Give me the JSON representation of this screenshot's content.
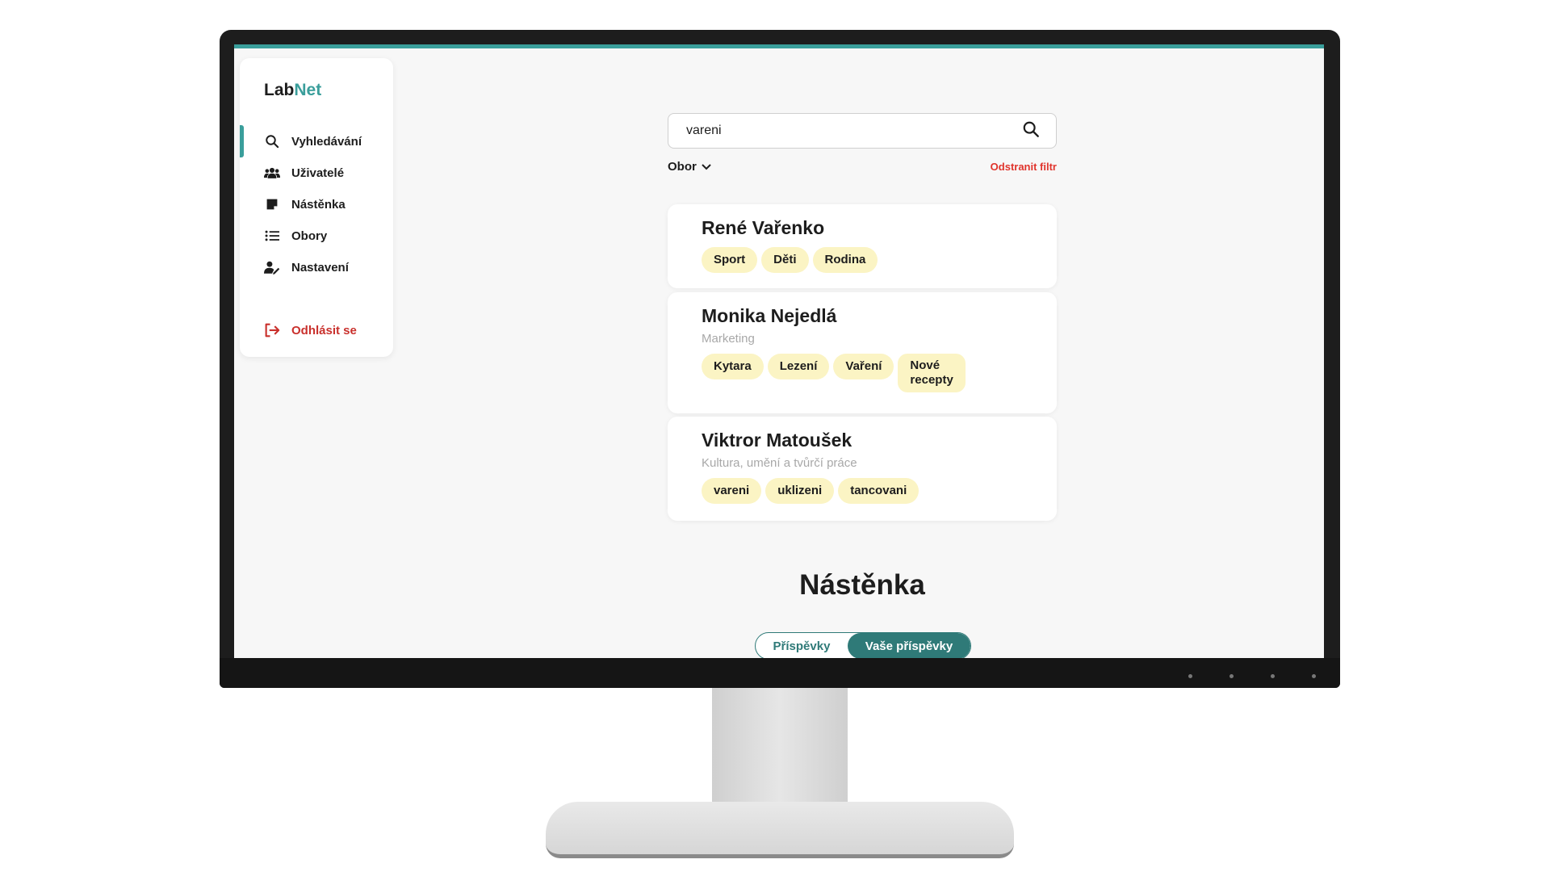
{
  "app": {
    "brand_part1": "Lab",
    "brand_part2": "Net",
    "accent_color": "#3a9e9b"
  },
  "sidebar": {
    "items": [
      {
        "label": "Vyhledávání",
        "icon": "search-icon",
        "active": true
      },
      {
        "label": "Uživatelé",
        "icon": "users-icon"
      },
      {
        "label": "Nástěnka",
        "icon": "note-icon"
      },
      {
        "label": "Obory",
        "icon": "list-icon"
      },
      {
        "label": "Nastavení",
        "icon": "user-settings-icon"
      }
    ],
    "logout": {
      "label": "Odhlásit se",
      "icon": "logout-icon",
      "color": "#c9302c"
    }
  },
  "search": {
    "value": "vareni",
    "icon": "search-icon"
  },
  "filter": {
    "dropdown_label": "Obor",
    "remove_label": "Odstranit filtr"
  },
  "results": [
    {
      "name": "René Vařenko",
      "dept": "",
      "tags": [
        "Sport",
        "Děti",
        "Rodina"
      ]
    },
    {
      "name": "Monika Nejedlá",
      "dept": "Marketing",
      "tags": [
        "Kytara",
        "Lezení",
        "Vaření",
        "Nové\nrecepty"
      ]
    },
    {
      "name": "Viktror Matoušek",
      "dept": "Kultura, umění a tvůrčí práce",
      "tags": [
        "vareni",
        "uklizeni",
        "tancovani"
      ]
    }
  ],
  "board": {
    "title": "Nástěnka",
    "tabs": [
      {
        "label": "Příspěvky",
        "selected": false
      },
      {
        "label": "Vaše příspěvky",
        "selected": true
      }
    ]
  }
}
